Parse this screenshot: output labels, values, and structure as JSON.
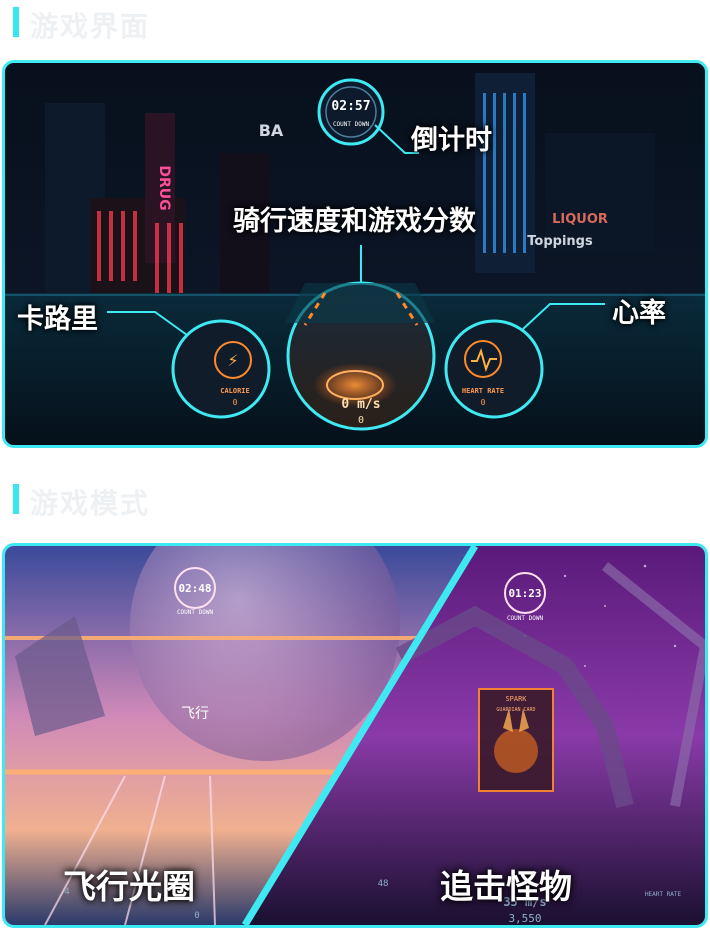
{
  "sections": [
    {
      "title": "游戏界面"
    },
    {
      "title": "游戏模式"
    }
  ],
  "hud": {
    "countdown": {
      "time": "02:57",
      "label": "COUNT DOWN"
    },
    "speed": {
      "value": "0 m/s",
      "sub": "0"
    },
    "calories": {
      "label": "CALORIE",
      "value": "0"
    },
    "heart_rate": {
      "label": "HEART RATE",
      "value": "0"
    },
    "signs": [
      "DRUG",
      "BA",
      "LIQUOR",
      "Toppings"
    ],
    "callouts": {
      "countdown": "倒计时",
      "speed": "骑行速度和游戏分数",
      "calories": "卡路里",
      "heart_rate": "心率"
    }
  },
  "modes": {
    "flight": {
      "label": "飞行光圈",
      "countdown_time": "02:48",
      "countdown_label": "COUNT DOWN",
      "center_text": "飞行",
      "calories_value": "4",
      "speed_sub": "0"
    },
    "chase": {
      "label": "追击怪物",
      "countdown_time": "01:23",
      "countdown_label": "COUNT DOWN",
      "card_title": "SPARK",
      "card_sub": "GUARDIAN CARD",
      "calories_value": "48",
      "speed_value": "35 m/s",
      "score": "3,550",
      "heart_label": "HEART RATE"
    }
  },
  "colors": {
    "accent": "#3ee9f2",
    "hud_orange": "#ff8a2a",
    "neon_pink": "#ff4f9a"
  }
}
